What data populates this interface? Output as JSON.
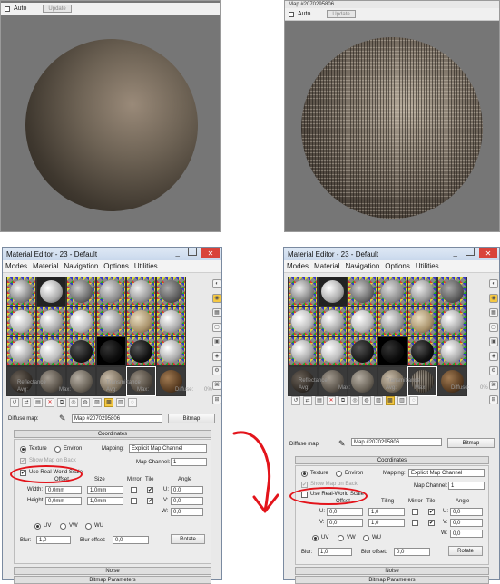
{
  "left_preview": {
    "auto_label": "Auto",
    "update_label": "Update"
  },
  "right_preview": {
    "title": "Map #2070295806",
    "auto_label": "Auto",
    "update_label": "Update"
  },
  "editor": {
    "title": "Material Editor - 23 - Default",
    "close_label": "✕",
    "menu": [
      "Modes",
      "Material",
      "Navigation",
      "Options",
      "Utilities"
    ],
    "reflectance_label": "Reflectance",
    "avg_label": "Avg:",
    "max_label": "Max:",
    "transmittance_label": "Transmittance",
    "diffuse_pct_label": "Diffuse:",
    "diffuse_pct_value": "0%",
    "diffuse_map_label": "Diffuse map:",
    "map_name": "Map #2070295806",
    "bitmap_label": "Bitmap",
    "coordinates_label": "Coordinates",
    "texture_label": "Texture",
    "environ_label": "Environ",
    "mapping_label": "Mapping:",
    "mapping_value": "Explicit Map Channel",
    "show_map_on_back": "Show Map on Back",
    "map_channel_label": "Map Channel:",
    "map_channel_value": "1",
    "use_real_world_scale": "Use Real-World Scale",
    "offset_label": "Offset",
    "size_label": "Size",
    "tiling_label": "Tiling",
    "mirror_label": "Mirror",
    "tile_label": "Tile",
    "angle_label": "Angle",
    "width_label": "Width:",
    "height_label": "Height:",
    "u_label": "U:",
    "v_label": "V:",
    "w_label": "W:",
    "zero_mm": "0,0mm",
    "one_mm": "1,0mm",
    "zero_val": "0,0",
    "one_val": "1,0",
    "uv_label": "UV",
    "vw_label": "VW",
    "wu_label": "WU",
    "blur_label": "Blur:",
    "blur_value": "1,0",
    "blur_offset_label": "Blur offset:",
    "blur_offset_value": "0,0",
    "rotate_label": "Rotate",
    "noise_label": "Noise",
    "bitmap_params_label": "Bitmap Parameters"
  },
  "colors": {
    "annotation": "#e3141b",
    "selected_tool": "#f5c842",
    "close_button": "#d9433a"
  }
}
